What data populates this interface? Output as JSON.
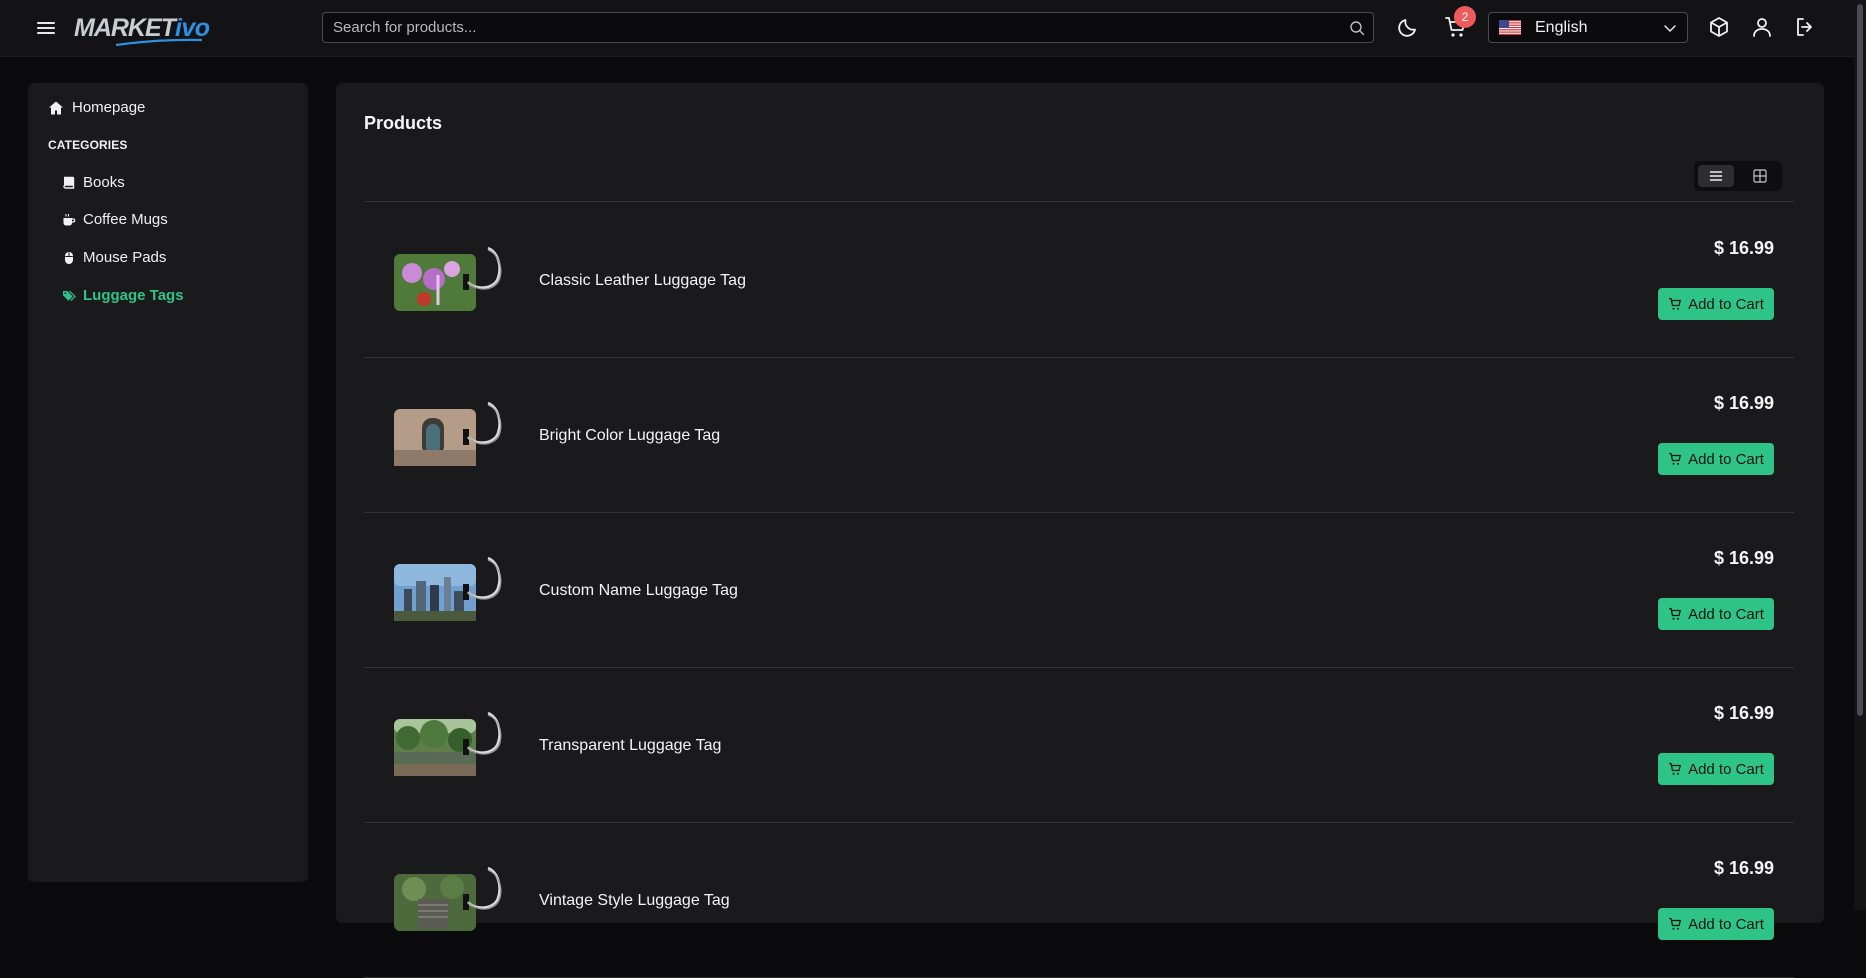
{
  "header": {
    "logo_left": "MARKET",
    "logo_right": "ivo",
    "search_placeholder": "Search for products...",
    "cart_count": "2",
    "language": "English"
  },
  "sidebar": {
    "home_label": "Homepage",
    "categories_title": "CATEGORIES",
    "categories": [
      {
        "label": "Books",
        "icon": "book-icon",
        "active": false
      },
      {
        "label": "Coffee Mugs",
        "icon": "mug-icon",
        "active": false
      },
      {
        "label": "Mouse Pads",
        "icon": "mouse-icon",
        "active": false
      },
      {
        "label": "Luggage Tags",
        "icon": "tags-icon",
        "active": true
      }
    ]
  },
  "main": {
    "title": "Products",
    "view_mode": "list",
    "add_label": "Add to Cart",
    "products": [
      {
        "name": "Classic Leather Luggage Tag",
        "price": "$ 16.99"
      },
      {
        "name": "Bright Color Luggage Tag",
        "price": "$ 16.99"
      },
      {
        "name": "Custom Name Luggage Tag",
        "price": "$ 16.99"
      },
      {
        "name": "Transparent Luggage Tag",
        "price": "$ 16.99"
      },
      {
        "name": "Vintage Style Luggage Tag",
        "price": "$ 16.99"
      }
    ]
  },
  "colors": {
    "accent": "#2fc487",
    "badge": "#ef5a5a",
    "brand_blue": "#2f8fe3"
  }
}
